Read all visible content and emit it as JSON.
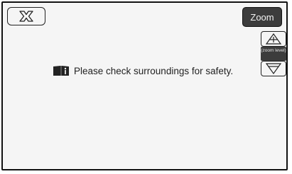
{
  "controls": {
    "close_icon": "close-x-icon",
    "zoom_label": "Zoom",
    "zoom_in_icon": "plus-arrow-up-icon",
    "zoom_level_label": "(zoom level)",
    "zoom_out_icon": "arrow-down-icon"
  },
  "message": {
    "icon": "manual-book-info-icon",
    "text": "Please check surroundings for safety."
  },
  "colors": {
    "background": "#f5f5f5",
    "dark_button": "#3c3c3c",
    "outline": "#222222"
  }
}
